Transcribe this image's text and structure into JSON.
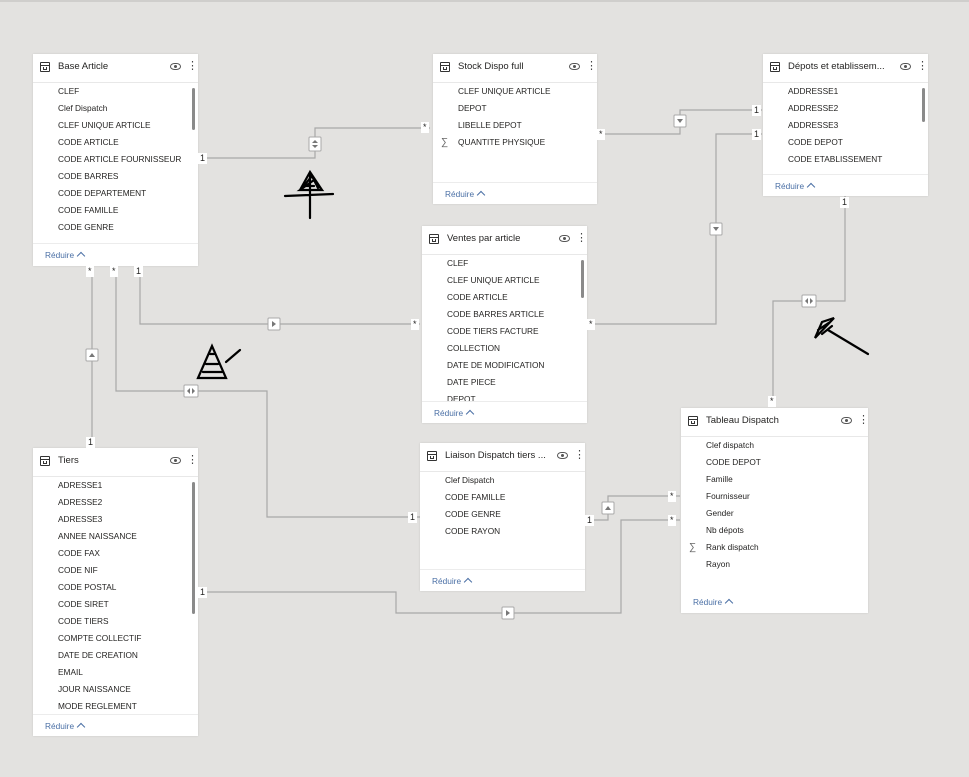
{
  "reduce_label": "Réduire",
  "tables": {
    "base_article": {
      "title": "Base Article",
      "fields": [
        "CLEF",
        "Clef Dispatch",
        "CLEF UNIQUE ARTICLE",
        "CODE ARTICLE",
        "CODE ARTICLE FOURNISSEUR",
        "CODE BARRES",
        "CODE DEPARTEMENT",
        "CODE FAMILLE",
        "CODE GENRE"
      ]
    },
    "stock_dispo": {
      "title": "Stock Dispo full",
      "fields": [
        "CLEF UNIQUE ARTICLE",
        "DEPOT",
        "LIBELLE DEPOT",
        "QUANTITE PHYSIQUE"
      ]
    },
    "depots": {
      "title": "Dépots et etablissem...",
      "fields": [
        "ADDRESSE1",
        "ADDRESSE2",
        "ADDRESSE3",
        "CODE DEPOT",
        "CODE ETABLISSEMENT"
      ]
    },
    "ventes": {
      "title": "Ventes par article",
      "fields": [
        "CLEF",
        "CLEF UNIQUE ARTICLE",
        "CODE ARTICLE",
        "CODE BARRES ARTICLE",
        "CODE TIERS FACTURE",
        "COLLECTION",
        "DATE DE MODIFICATION",
        "DATE PIECE",
        "DEPOT"
      ]
    },
    "tiers": {
      "title": "Tiers",
      "fields": [
        "ADRESSE1",
        "ADRESSE2",
        "ADRESSE3",
        "ANNEE NAISSANCE",
        "CODE FAX",
        "CODE NIF",
        "CODE POSTAL",
        "CODE SIRET",
        "CODE TIERS",
        "COMPTE COLLECTIF",
        "DATE DE CREATION",
        "EMAIL",
        "JOUR NAISSANCE",
        "MODE REGLEMENT"
      ]
    },
    "liaison": {
      "title": "Liaison Dispatch tiers ...",
      "fields": [
        "Clef Dispatch",
        "CODE FAMILLE",
        "CODE GENRE",
        "CODE RAYON"
      ]
    },
    "tableau": {
      "title": "Tableau Dispatch",
      "fields": [
        "Clef dispatch",
        "CODE DEPOT",
        "Famille",
        "Fournisseur",
        "Gender",
        "Nb dépots",
        "Rank dispatch",
        "Rayon"
      ]
    }
  },
  "cardinality": {
    "one": "1",
    "many": "*"
  },
  "colors": {
    "canvas": "#e3e2e0",
    "line": "#a8a8a8",
    "link": "#4a6fa5",
    "ink": "#000000"
  }
}
